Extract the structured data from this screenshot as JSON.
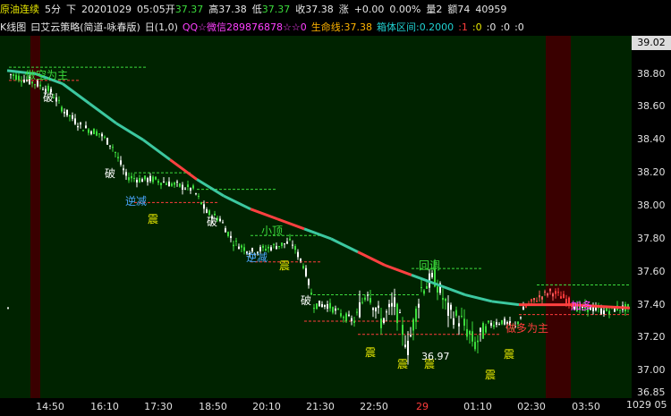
{
  "topbar": {
    "symbol": "原油连续",
    "period": "5分",
    "direction": "下",
    "date": "20201029",
    "time": "05:05",
    "open_label": "开",
    "open": "37.37",
    "high_label": "高",
    "high": "37.38",
    "low_label": "低",
    "low": "37.37",
    "close_label": "收",
    "close": "37.38",
    "change_label": "涨",
    "change": "+0.00",
    "change_pct": "0.00%",
    "volume_label": "量",
    "volume": "2",
    "amount_label": "额",
    "amount": "74",
    "oi": "40959"
  },
  "infobar": {
    "chart_kind": "K线图",
    "strategy": "曰艾云策略(简道-咏春版)",
    "params": "日(1,0)",
    "contact": "QQ☆微信289876878☆☆0",
    "lifeline_label": "生命线:",
    "lifeline": "37.38",
    "box_label": "箱体区间:",
    "box": "0.2000",
    "v1": ":1",
    "v2": ":0",
    "v3": ":0",
    "v4": ":0",
    "v5": ":0"
  },
  "axis": {
    "y_top": "39.02",
    "y_ticks": [
      "38.80",
      "38.60",
      "38.40",
      "38.20",
      "38.00",
      "37.80",
      "37.60",
      "37.40",
      "37.20",
      "37.00",
      "36.85"
    ],
    "x_ticks": [
      "14:50",
      "16:10",
      "17:30",
      "18:50",
      "20:10",
      "21:30",
      "22:50",
      "29",
      "01:10",
      "02:30",
      "03:50"
    ],
    "x_last": "1029 05"
  },
  "annotations": {
    "po": "破",
    "zhen": "震",
    "lian_jian": "逆减",
    "xiao_ding": "小顶",
    "hui_diao": "回调",
    "duo": "做多为主",
    "kong": "做空为主",
    "low_value": "36.97",
    "jia_duo": "加多"
  },
  "chart_data": {
    "type": "candlestick",
    "ylim": [
      36.85,
      39.02
    ],
    "colors": {
      "up": "#ffffff",
      "down": "#3cdc3c",
      "trend_up": "#ff4040",
      "trend_down": "#3cc8a0",
      "bg": "#002300",
      "band": "#3a0000"
    }
  }
}
